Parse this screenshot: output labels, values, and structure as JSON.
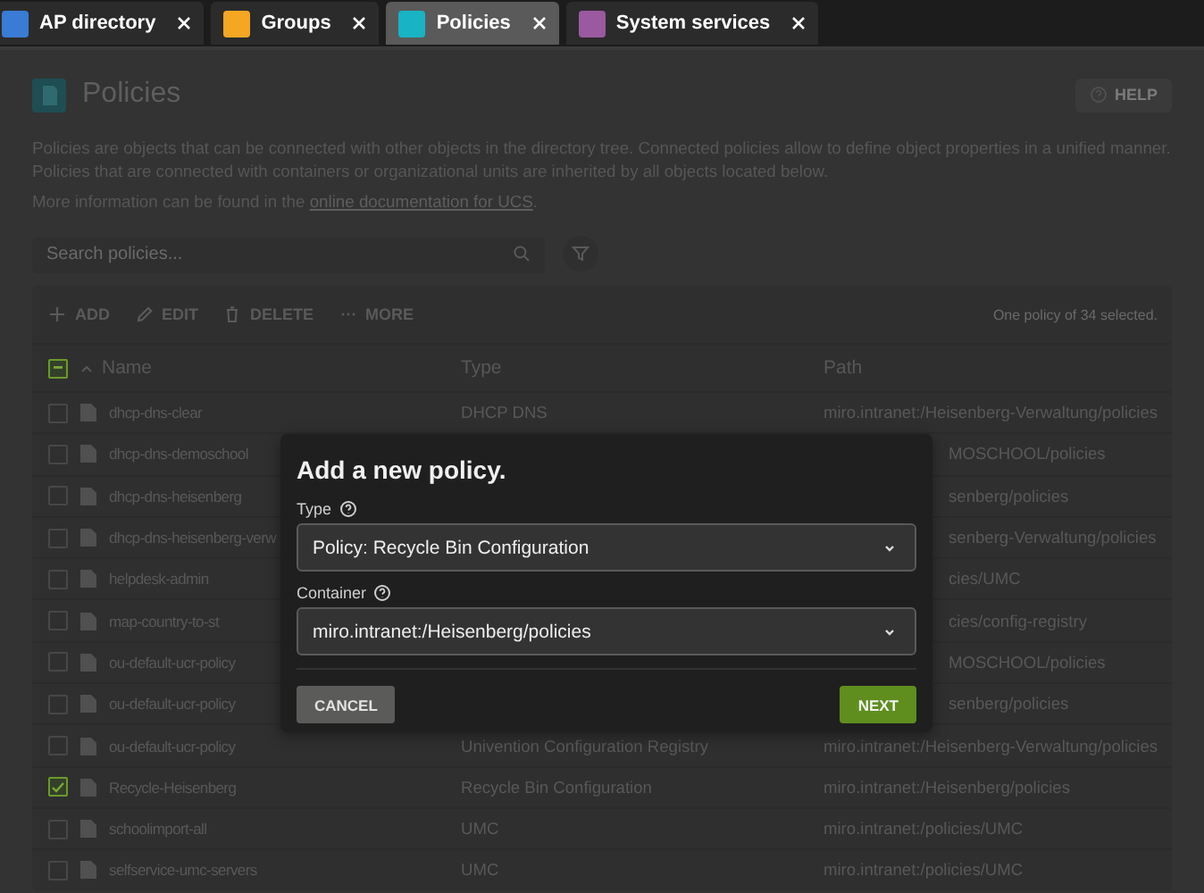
{
  "tabs": [
    {
      "label": "AP directory",
      "selected": false,
      "color": "#3a7bd5"
    },
    {
      "label": "Groups",
      "selected": false,
      "color": "#f5a623"
    },
    {
      "label": "Policies",
      "selected": true,
      "color": "#18b3c4"
    },
    {
      "label": "System services",
      "selected": false,
      "color": "#9b59a0"
    }
  ],
  "page": {
    "title": "Policies",
    "help_button": "HELP",
    "description": "Policies are objects that can be connected with other objects in the directory tree. Connected policies allow to define object properties in a unified manner. Policies that are connected with containers or organizational units are inherited by all objects located below.",
    "more_info": {
      "text": "More information can be found in the",
      "link": "online documentation for UCS",
      "end": "."
    }
  },
  "search": {
    "placeholder": "Search policies..."
  },
  "toolbar": {
    "actions": [
      {
        "label": "ADD",
        "kind": "add"
      },
      {
        "label": "EDIT",
        "kind": "edit"
      },
      {
        "label": "DELETE",
        "kind": "delete"
      },
      {
        "label": "MORE",
        "kind": "more"
      }
    ],
    "status": "One policy of 34 selected."
  },
  "table": {
    "select_all": {
      "indeterminate": true
    },
    "columns": [
      {
        "label": "Name",
        "sorted": true
      },
      {
        "label": "Type",
        "sorted": false
      },
      {
        "label": "Path",
        "sorted": false
      }
    ],
    "rows": [
      {
        "name": "dhcp-dns-clear",
        "type": "DHCP DNS",
        "path": "miro.intranet:/Heisenberg-Verwaltung/policies",
        "checked": false
      },
      {
        "name": "dhcp-dns-demoschool",
        "path": "MOSCHOOL/policies",
        "checked": false
      },
      {
        "name": "dhcp-dns-heisenberg",
        "path": "senberg/policies",
        "checked": false
      },
      {
        "name": "dhcp-dns-heisenberg-verw",
        "path": "senberg-Verwaltung/policies",
        "checked": false
      },
      {
        "name": "helpdesk-admin",
        "path": "cies/UMC",
        "checked": false
      },
      {
        "name": "map-country-to-st",
        "path": "cies/config-registry",
        "checked": false
      },
      {
        "name": "ou-default-ucr-policy",
        "path": "MOSCHOOL/policies",
        "checked": false
      },
      {
        "name": "ou-default-ucr-policy",
        "path": "senberg/policies",
        "checked": false
      },
      {
        "name": "ou-default-ucr-policy",
        "type": "Univention Configuration Registry",
        "path": "miro.intranet:/Heisenberg-Verwaltung/policies",
        "checked": false
      },
      {
        "name": "Recycle-Heisenberg",
        "type": "Recycle Bin Configuration",
        "path": "miro.intranet:/Heisenberg/policies",
        "checked": true
      },
      {
        "name": "schoolimport-all",
        "type": "UMC",
        "path": "miro.intranet:/policies/UMC",
        "checked": false
      },
      {
        "name": "selfservice-umc-servers",
        "type": "UMC",
        "path": "miro.intranet:/policies/UMC",
        "checked": false
      }
    ]
  },
  "dialog": {
    "title": "Add a new policy.",
    "fields": [
      {
        "label": "Type",
        "value": "Policy: Recycle Bin Configuration"
      },
      {
        "label": "Container",
        "value": "miro.intranet:/Heisenberg/policies"
      }
    ],
    "buttons": [
      {
        "label": "CANCEL",
        "kind": "secondary"
      },
      {
        "label": "NEXT",
        "kind": "primary"
      }
    ]
  }
}
